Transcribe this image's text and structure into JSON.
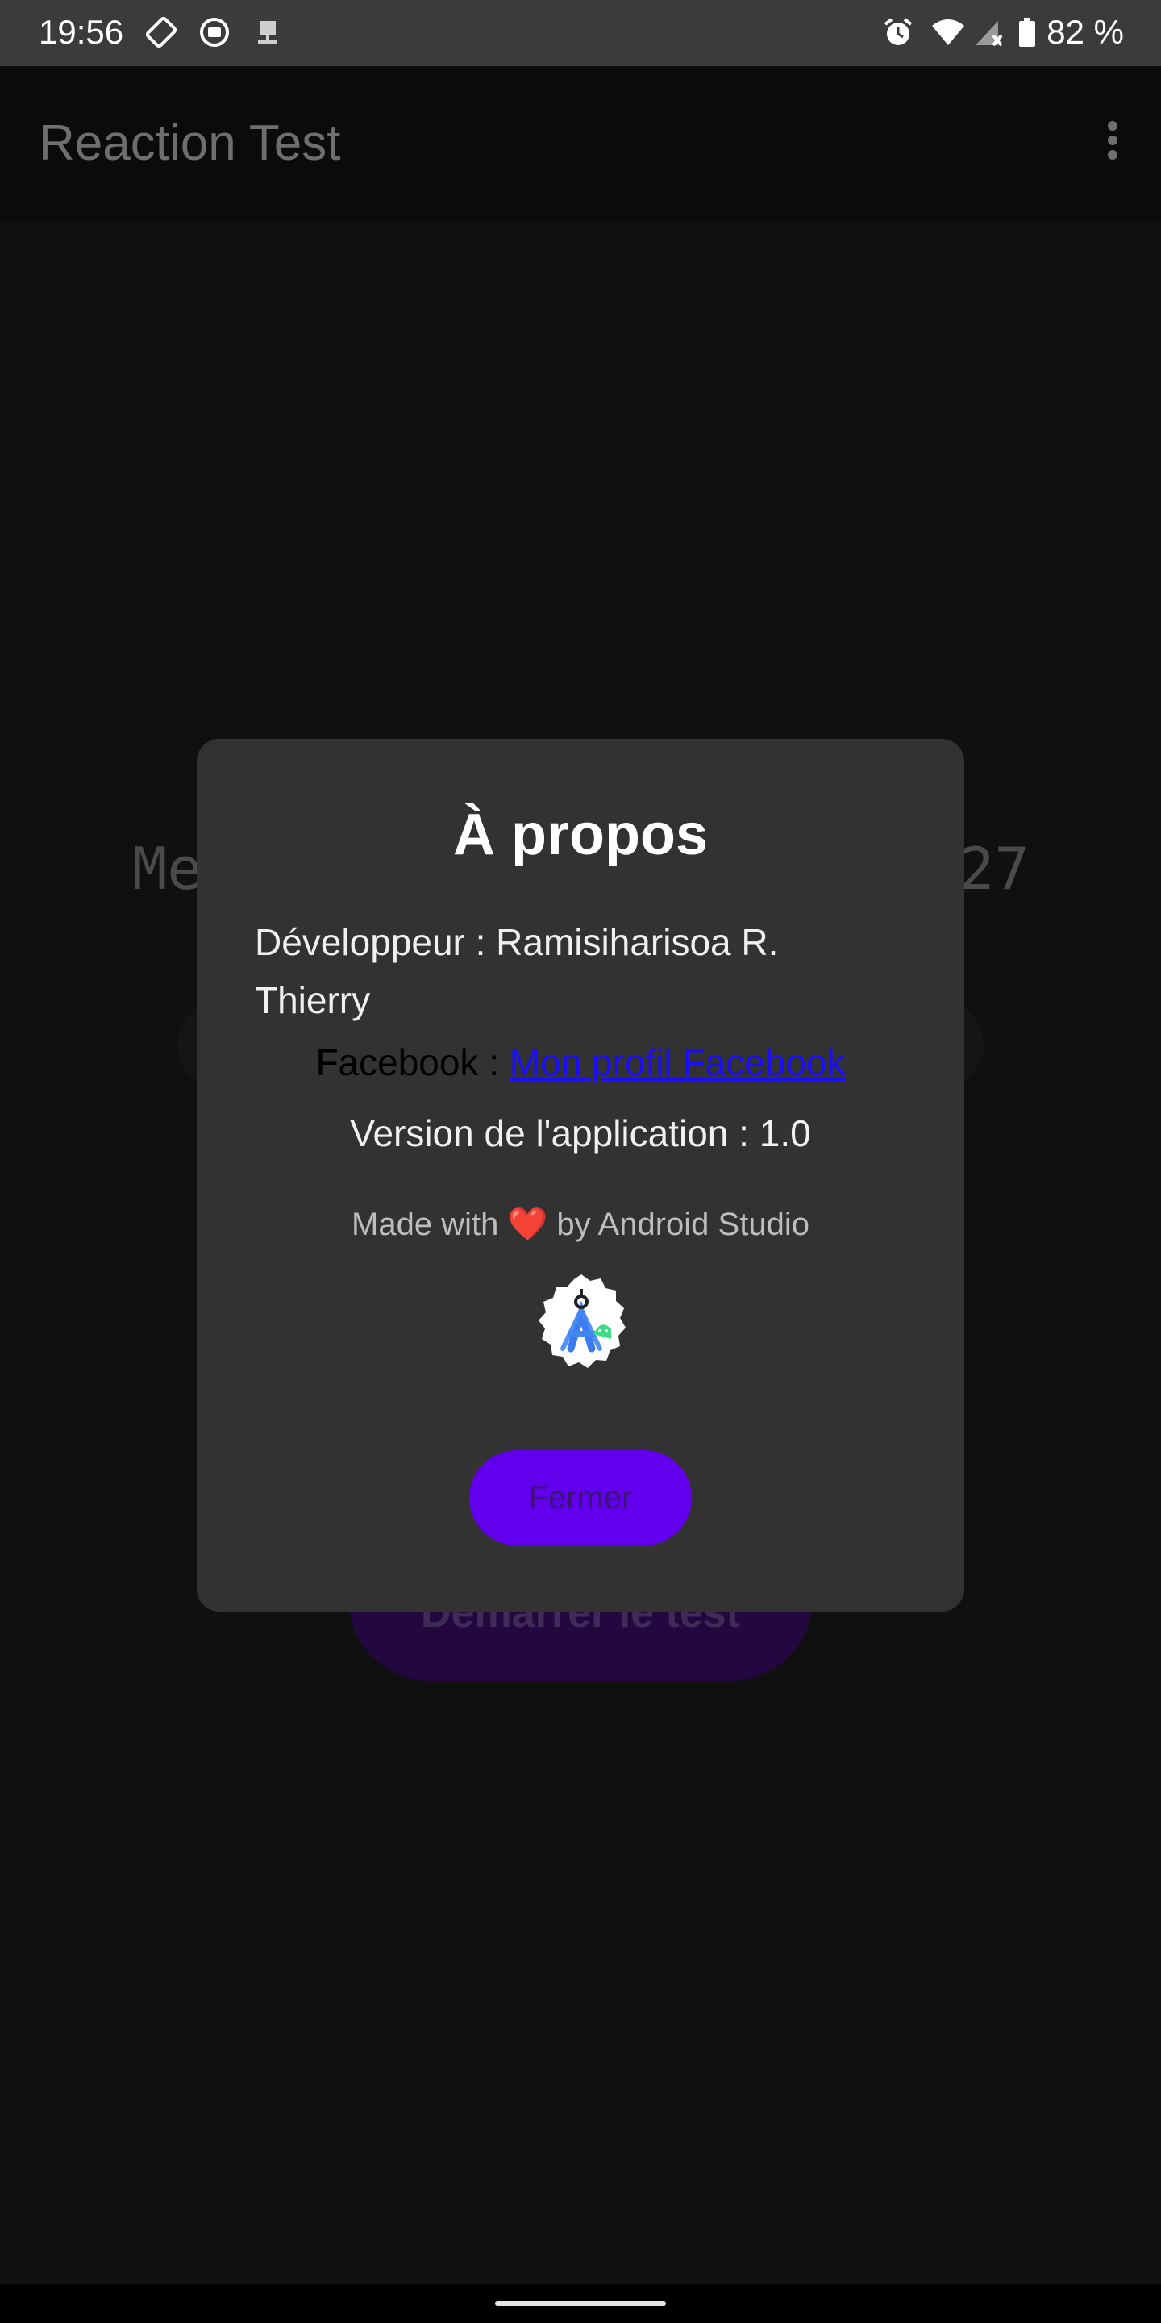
{
  "status_bar": {
    "time": "19:56",
    "battery": "82 %",
    "icons": [
      "screen-rotate-icon",
      "cast-icon",
      "network-storage-icon",
      "alarm-icon",
      "wifi-icon",
      "cell-signal-icon",
      "battery-icon"
    ]
  },
  "app_bar": {
    "title": "Reaction Test",
    "menu_icon": "more-vert-icon"
  },
  "background": {
    "label_left": "Me",
    "label_right": "27",
    "start_button": "Démarrer le test"
  },
  "dialog": {
    "title": "À propos",
    "developer": "Développeur : Ramisiharisoa R. Thierry",
    "facebook_label": "Facebook : ",
    "facebook_link": "Mon profil Facebook",
    "version": "Version de l'application : 1.0",
    "made_with_prefix": "Made with ",
    "heart": "❤️",
    "made_with_suffix": " by Android Studio",
    "logo_icon": "android-studio-icon",
    "close_button": "Fermer"
  },
  "colors": {
    "accent": "#6200ee",
    "dialog_bg": "#323233",
    "link": "#1a0dff"
  }
}
